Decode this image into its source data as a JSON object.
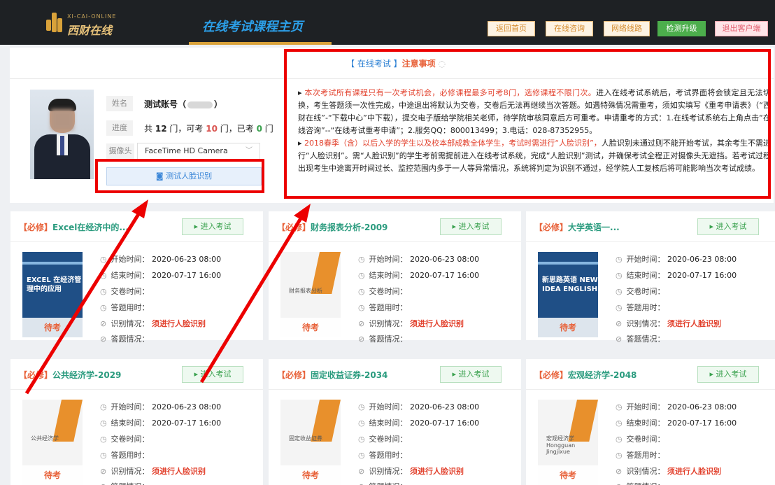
{
  "header": {
    "logo_en": "XI-CAI-ONLINE",
    "logo_cn": "西财在线",
    "title": "在线考试课程主页",
    "buttons": [
      "返回首页",
      "在线咨询",
      "网络线路",
      "检测升级",
      "退出客户端"
    ]
  },
  "student": {
    "name_label": "姓名",
    "name_value": "测试账号（",
    "name_suffix": "）",
    "progress_label": "进度",
    "progress_pre": "共",
    "total": "12",
    "progress_mid1": "门，可考",
    "available": "10",
    "progress_mid2": "门，已考",
    "taken": "0",
    "progress_post": "门",
    "camera_label": "摄像头",
    "camera_value": "FaceTime HD Camera",
    "face_button": "测试人脸识别"
  },
  "notice": {
    "title_main": "【 在线考试 】",
    "title_sub": "注意事项",
    "p1_red": "本次考试所有课程只有一次考试机会，必修课程最多可考8门，选修课程不限门次。",
    "p1_black": "进入在线考试系统后，考试界面将会锁定且无法切换，考生答题须一次性完成，中途退出将默认为交卷，交卷后无法再继续当次答题。如遇特殊情况需重考，须如实填写《重考申请表》（“西财在线”-“下载中心”中下载），提交电子版给学院相关老师，待学院审核同意后方可重考。申请重考的方式：1.在线考试系统右上角点击“在线咨询”--“在线考试重考申请”；2.服务QQ：800013499；3.电话：028-87352955。",
    "p2_red": "2018春季（含）以后入学的学生以及校本部成教全体学生，考试时需进行“人脸识别”，",
    "p2_black": "人脸识别未通过则不能开始考试，其余考生不需进行“人脸识别”。需“人脸识别”的学生考前需提前进入在线考试系统，完成“人脸识别”测试，并确保考试全程正对摄像头无遮挡。若考试过程出现考生中途离开时间过长、监控范围内多于一人等异常情况，系统将判定为识别不通过，经学院人工复核后将可能影响当次考试成绩。"
  },
  "labels": {
    "enter": "进入考试",
    "start": "开始时间：",
    "end": "结束时间：",
    "submit": "交卷时间：",
    "duration": "答题用时：",
    "recog": "识别情况：",
    "result": "答题情况：",
    "recog_value": "须进行人脸识别",
    "status": "待考"
  },
  "courses": [
    {
      "tag": "【必修】",
      "name": "Excel在经济中的...",
      "start": "2020-06-23 08:00",
      "end": "2020-07-17 16:00",
      "cover": "EXCEL 在经济管理中的应用"
    },
    {
      "tag": "【必修】",
      "name": "财务报表分析-2009",
      "start": "2020-06-23 08:00",
      "end": "2020-07-17 16:00",
      "cover": "财务报表分析"
    },
    {
      "tag": "【必修】",
      "name": "大学英语一...",
      "start": "2020-06-23 08:00",
      "end": "2020-07-17 16:00",
      "cover": "新思路英语 NEW IDEA ENGLISH"
    },
    {
      "tag": "【必修】",
      "name": "公共经济学-2029",
      "start": "2020-06-23 08:00",
      "end": "2020-07-17 16:00",
      "cover": "公共经济学"
    },
    {
      "tag": "【必修】",
      "name": "固定收益证券-2034",
      "start": "2020-06-23 08:00",
      "end": "2020-07-17 16:00",
      "cover": "固定收益证券"
    },
    {
      "tag": "【必修】",
      "name": "宏观经济学-2048",
      "start": "2020-06-23 08:00",
      "end": "2020-07-17 16:00",
      "cover": "宏观经济学 Hongguan Jingjixue"
    }
  ],
  "colors": {
    "accent": "#d9a23a",
    "annotation_red": "#ec0000",
    "title_blue": "#2c9fe8",
    "course_green": "#2a9b7e"
  }
}
